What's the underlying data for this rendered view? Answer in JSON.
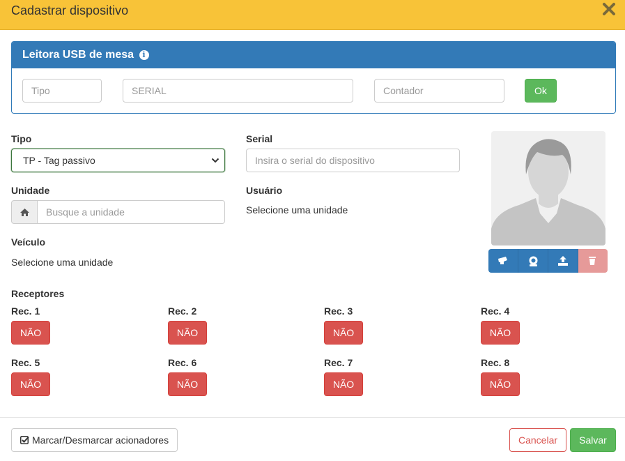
{
  "modal": {
    "title": "Cadastrar dispositivo",
    "close_icon": "close-icon"
  },
  "reader": {
    "heading": "Leitora USB de mesa",
    "info_icon": "info-icon",
    "tipo_placeholder": "Tipo",
    "serial_placeholder": "SERIAL",
    "contador_placeholder": "Contador",
    "ok_label": "Ok"
  },
  "form": {
    "tipo_label": "Tipo",
    "tipo_value": "TP - Tag passivo",
    "serial_label": "Serial",
    "serial_placeholder": "Insira o serial do dispositivo",
    "unidade_label": "Unidade",
    "unidade_placeholder": "Busque a unidade",
    "usuario_label": "Usuário",
    "usuario_value": "Selecione uma unidade",
    "veiculo_label": "Veículo",
    "veiculo_value": "Selecione uma unidade"
  },
  "photo": {
    "icons": [
      "camera-icon",
      "webcam-icon",
      "upload-icon",
      "trash-icon"
    ]
  },
  "receptores": {
    "title": "Receptores",
    "items": [
      {
        "label": "Rec. 1",
        "value": "NÃO"
      },
      {
        "label": "Rec. 2",
        "value": "NÃO"
      },
      {
        "label": "Rec. 3",
        "value": "NÃO"
      },
      {
        "label": "Rec. 4",
        "value": "NÃO"
      },
      {
        "label": "Rec. 5",
        "value": "NÃO"
      },
      {
        "label": "Rec. 6",
        "value": "NÃO"
      },
      {
        "label": "Rec. 7",
        "value": "NÃO"
      },
      {
        "label": "Rec. 8",
        "value": "NÃO"
      }
    ]
  },
  "footer": {
    "toggle_label": "Marcar/Desmarcar acionadores",
    "cancel_label": "Cancelar",
    "save_label": "Salvar"
  },
  "colors": {
    "header_bg": "#f8c338",
    "primary": "#337ab7",
    "success": "#5cb85c",
    "danger": "#d9534f"
  }
}
